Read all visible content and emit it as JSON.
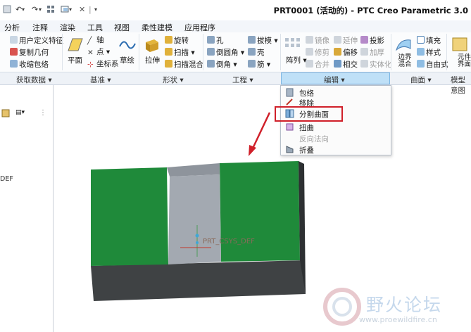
{
  "window": {
    "title": "PRT0001 (活动的) - PTC Creo Parametric 3.0"
  },
  "menu": {
    "tabs": [
      "分析",
      "注释",
      "渲染",
      "工具",
      "视图",
      "柔性建模",
      "应用程序"
    ]
  },
  "ribbon": {
    "get_data": {
      "user_feature": "用户定义特征",
      "copy_geometry": "复制几何",
      "shrinkwrap": "收缩包络"
    },
    "datum": {
      "plane": "平面",
      "axis": "轴",
      "point": "点",
      "csys": "坐标系",
      "sketch": "草绘"
    },
    "shapes": {
      "extrude": "拉伸",
      "revolve": "旋转",
      "sweep": "扫描",
      "swept_blend": "扫描混合"
    },
    "engineering": {
      "hole": "孔",
      "round": "倒圆角",
      "chamfer": "倒角",
      "draft": "拔模",
      "shell": "壳",
      "rib": "筋"
    },
    "editing": {
      "pattern": "阵列",
      "mirror": "镜像",
      "trim": "修剪",
      "merge": "合并",
      "extend": "延伸",
      "offset": "偏移",
      "intersect": "相交",
      "project": "投影",
      "thicken": "加厚",
      "solidify": "实体化"
    },
    "surfaces": {
      "boundary_blend": "边界混合",
      "fill": "填充",
      "style": "样式",
      "freestyle": "自由式"
    },
    "model_intent": {
      "label": "元件界面"
    }
  },
  "groups": {
    "get_data": "获取数据",
    "datum": "基准",
    "shapes": "形状",
    "engineering": "工程",
    "editing": "编辑",
    "surfaces": "曲面",
    "model_intent": "模型意图"
  },
  "dropdown": {
    "items": [
      {
        "label": "包络",
        "enabled": true
      },
      {
        "label": "移除",
        "enabled": true
      },
      {
        "label": "分割曲面",
        "enabled": true,
        "highlighted": true
      },
      {
        "label": "扭曲",
        "enabled": true
      },
      {
        "label": "反向法向",
        "enabled": false
      },
      {
        "label": "折叠",
        "enabled": true
      }
    ]
  },
  "left_panel": {
    "model_tree_suffix": "DEF"
  },
  "model": {
    "csys_label": "PRT_CSYS_DEF"
  },
  "watermark": {
    "text": "野火论坛",
    "url": "www.proewildfire.cn"
  },
  "colors": {
    "model_green": "#1f8a3a",
    "model_dark": "#3f4244",
    "model_gray": "#a3a9b1",
    "highlight_red": "#d0202a",
    "group_edit_bg": "#bfe0f7"
  }
}
